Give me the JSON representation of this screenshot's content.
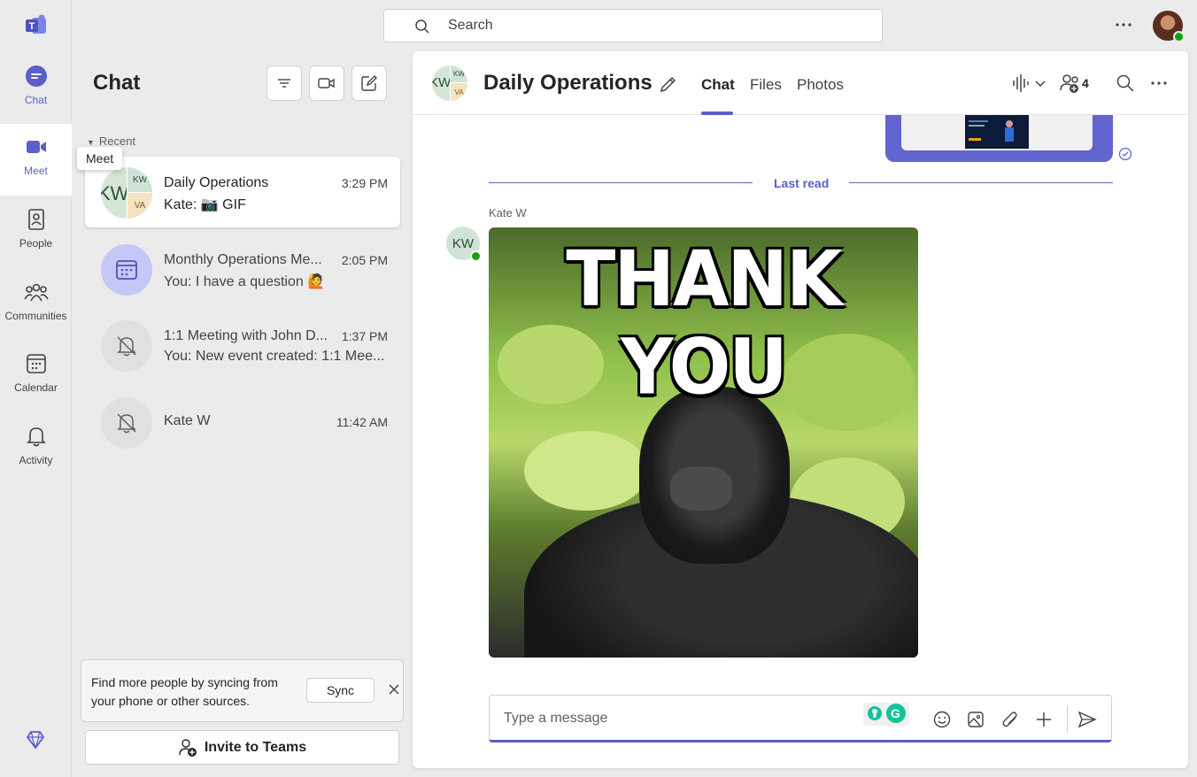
{
  "rail": {
    "items": [
      {
        "label": "Chat"
      },
      {
        "label": "Meet"
      },
      {
        "label": "People"
      },
      {
        "label": "Communities"
      },
      {
        "label": "Calendar"
      },
      {
        "label": "Activity"
      }
    ],
    "tooltip": "Meet"
  },
  "search": {
    "placeholder": "Search"
  },
  "list": {
    "title": "Chat",
    "section_label": "Recent",
    "chats": [
      {
        "name": "Daily Operations",
        "time": "3:29 PM",
        "preview": "Kate: 📷 GIF",
        "avatar_initials_main": "KW",
        "avatar_q1": "KW",
        "avatar_q2": "VA"
      },
      {
        "name": "Monthly Operations Me...",
        "time": "2:05 PM",
        "preview": "You: I have a question 🙋"
      },
      {
        "name": "1:1 Meeting with John D...",
        "time": "1:37 PM",
        "preview": "You: New event created: 1:1 Mee..."
      },
      {
        "name": "Kate W",
        "time": "11:42 AM",
        "preview": ""
      }
    ]
  },
  "sync": {
    "text": "Find more people by syncing from your phone or other sources.",
    "button": "Sync"
  },
  "invite": {
    "label": "Invite to Teams"
  },
  "conversation": {
    "title": "Daily Operations",
    "tabs": [
      "Chat",
      "Files",
      "Photos"
    ],
    "active_tab": "Chat",
    "participants_count": "4",
    "last_read_label": "Last read",
    "message": {
      "sender": "Kate W",
      "sender_initials": "KW",
      "gif_text": "THANK YOU"
    },
    "composer_placeholder": "Type a message"
  },
  "colors": {
    "accent": "#5b5fc7",
    "presence_available": "#13a10e"
  }
}
